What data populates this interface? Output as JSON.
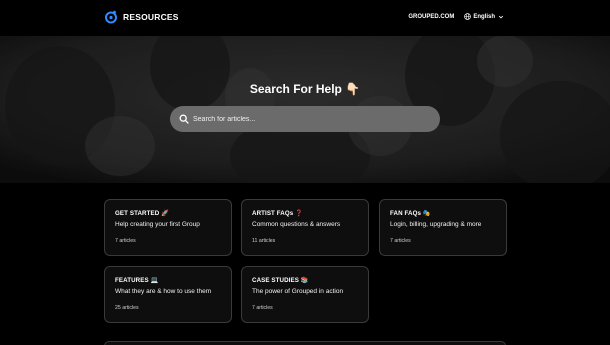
{
  "header": {
    "brand": "RESOURCES",
    "nav_link": "GROUPED.COM",
    "language": "English"
  },
  "hero": {
    "title": "Search For Help 👇🏻",
    "search_placeholder": "Search for articles..."
  },
  "cards": [
    {
      "title": "GET STARTED 🚀",
      "description": "Help creating your first Group",
      "count": "7 articles"
    },
    {
      "title": "ARTIST FAQs ❓",
      "description": "Common questions & answers",
      "count": "11 articles"
    },
    {
      "title": "FAN FAQs 🎭",
      "description": "Login, billing, upgrading & more",
      "count": "7 articles"
    },
    {
      "title": "FEATURES 💻",
      "description": "What they are & how to use them",
      "count": "25 articles"
    },
    {
      "title": "CASE STUDIES 📚",
      "description": "The power of Grouped in action",
      "count": "7 articles"
    }
  ],
  "colors": {
    "background": "#000000",
    "brand_blue": "#2f8cff",
    "card_border": "#3a3a3a",
    "search_bg": "#6b6b6b"
  }
}
